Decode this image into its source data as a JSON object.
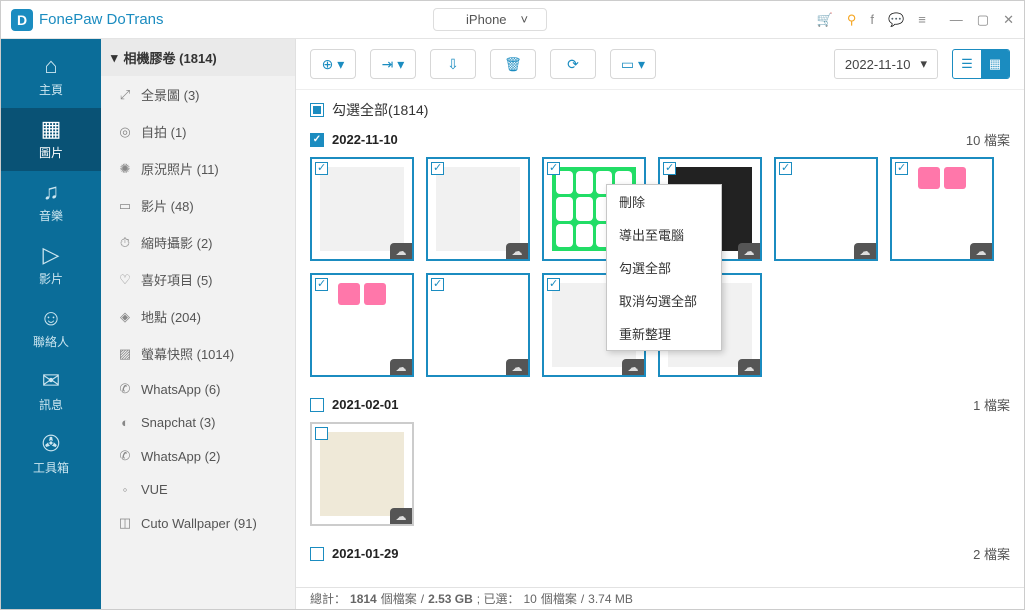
{
  "app": {
    "title": "FonePaw DoTrans"
  },
  "device": {
    "platform_icon": "apple",
    "name": "iPhone"
  },
  "window_icons": {
    "cart": "🛒",
    "key": "⚲",
    "fb": "f",
    "chat": "💬",
    "menu": "≡",
    "min": "—",
    "max": "▢",
    "close": "✕"
  },
  "nav": [
    {
      "icon": "⌂",
      "label": "主頁"
    },
    {
      "icon": "▦",
      "label": "圖片",
      "active": true
    },
    {
      "icon": "♫",
      "label": "音樂"
    },
    {
      "icon": "▷",
      "label": "影片"
    },
    {
      "icon": "☺",
      "label": "聯絡人"
    },
    {
      "icon": "✉",
      "label": "訊息"
    },
    {
      "icon": "✇",
      "label": "工具箱"
    }
  ],
  "category_header": {
    "caret": "▾",
    "label": "相機膠卷",
    "count": "(1814)"
  },
  "categories": [
    {
      "icon": "⤢",
      "label": "全景圖 (3)"
    },
    {
      "icon": "◎",
      "label": "自拍 (1)"
    },
    {
      "icon": "✺",
      "label": "原況照片 (11)"
    },
    {
      "icon": "▭",
      "label": "影片 (48)"
    },
    {
      "icon": "⏱",
      "label": "縮時攝影 (2)"
    },
    {
      "icon": "♡",
      "label": "喜好項目 (5)"
    },
    {
      "icon": "◈",
      "label": "地點 (204)"
    },
    {
      "icon": "▨",
      "label": "螢幕快照 (1014)"
    },
    {
      "icon": "✆",
      "label": "WhatsApp (6)"
    },
    {
      "icon": "◐",
      "label": "Snapchat (3)"
    },
    {
      "icon": "✆",
      "label": "WhatsApp (2)"
    },
    {
      "icon": "◦",
      "label": "VUE"
    },
    {
      "icon": "◫",
      "label": "Cuto Wallpaper (91)"
    }
  ],
  "toolbar_icons": {
    "add": "⊕",
    "to_device": "⇥",
    "to_pc": "⇩",
    "delete": "🗑",
    "refresh": "⟳",
    "folder": "▭"
  },
  "date_filter": {
    "value": "2022-11-10"
  },
  "view": {
    "list_icon": "☰",
    "grid_icon": "▦"
  },
  "select_all": {
    "label": "勾選全部(1814)"
  },
  "sections": [
    {
      "date": "2022-11-10",
      "count_label": "10 檔案",
      "checked": true,
      "thumbs": 10
    },
    {
      "date": "2021-02-01",
      "count_label": "1 檔案",
      "checked": false,
      "thumbs": 1
    },
    {
      "date": "2021-01-29",
      "count_label": "2 檔案",
      "checked": false,
      "thumbs": 0
    }
  ],
  "context_menu": [
    "刪除",
    "導出至電腦",
    "勾選全部",
    "取消勾選全部",
    "重新整理"
  ],
  "status": {
    "prefix": "總計：",
    "total_files": "1814",
    "total_files_unit": "個檔案",
    "total_size": "2.53 GB",
    "sep": "; 已選：",
    "sel_files": "10",
    "sel_files_unit": "個檔案",
    "sel_size": "3.74 MB"
  }
}
